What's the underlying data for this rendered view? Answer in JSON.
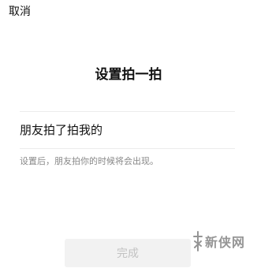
{
  "header": {
    "cancel_label": "取消"
  },
  "main": {
    "title": "设置拍一拍",
    "input_value": "朋友拍了拍我的",
    "hint": "设置后，朋友拍你的时候将会出现。",
    "done_label": "完成"
  },
  "watermark": {
    "text": "新侠网"
  },
  "colors": {
    "button_bg": "#f2f2f2",
    "button_text_disabled": "#c2c2c2",
    "hint_text": "#888888",
    "divider": "#ececec"
  }
}
